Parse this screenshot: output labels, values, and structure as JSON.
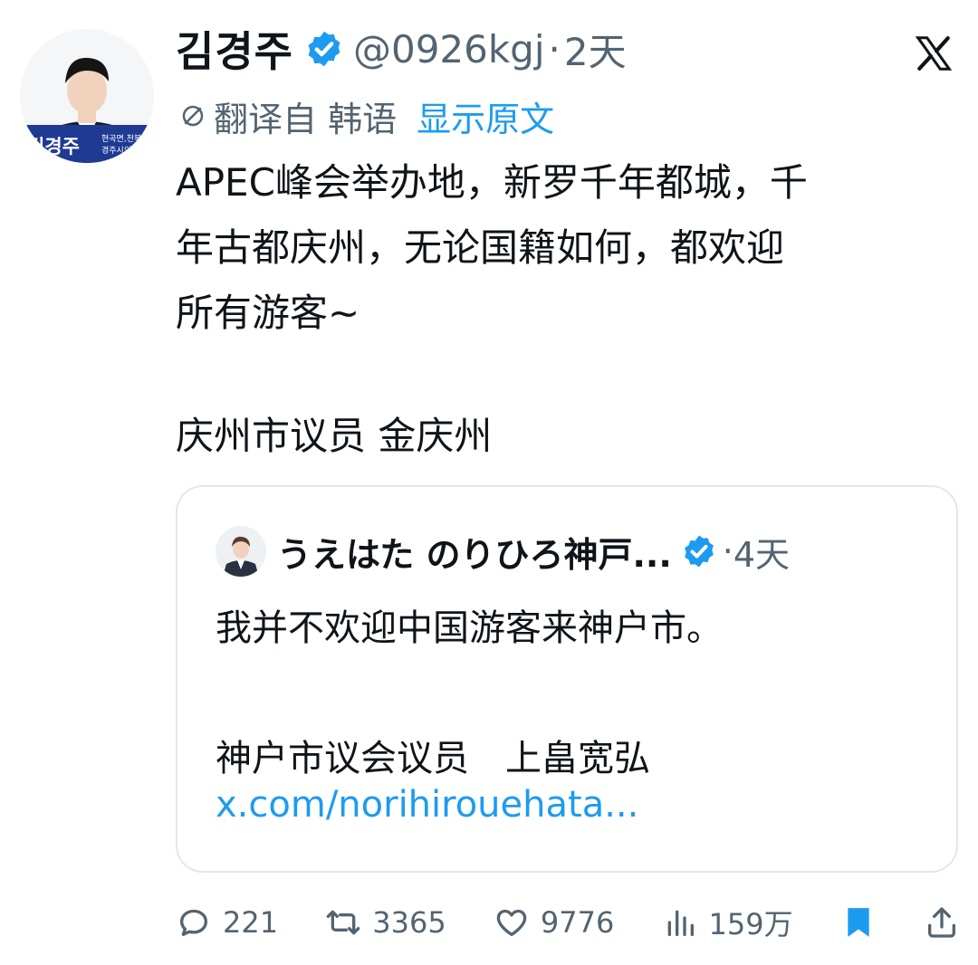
{
  "header": {
    "name": "김경주",
    "handle": "@0926kgj",
    "separator": "·",
    "time": "2天",
    "avatar_banner_name": "김경주",
    "avatar_banner_line1": "현곡면,천북면",
    "avatar_banner_line2": "경주시의원"
  },
  "translation": {
    "label": "翻译自 韩语",
    "show_original": "显示原文"
  },
  "tweet": {
    "text": "APEC峰会举办地，新罗千年都城，千\n年古都庆州，无论国籍如何，都欢迎\n所有游客~",
    "signature": "庆州市议员 金庆州"
  },
  "quote": {
    "name": "うえはた のりひろ神戸...",
    "separator": "·",
    "time": "4天",
    "text": "我并不欢迎中国游客来神户市。\n\n神户市议会议员　上畠宽弘",
    "link": "x.com/norihirouehata..."
  },
  "actions": {
    "replies": "221",
    "retweets": "3365",
    "likes": "9776",
    "views": "159万"
  },
  "colors": {
    "accent": "#1d9bf0",
    "secondary_text": "#536471",
    "primary_text": "#0f1419",
    "border": "#e1e8ed",
    "avatar_banner": "#1f3a93"
  },
  "icons": [
    "verified-badge-icon",
    "x-logo-icon",
    "translate-icon",
    "reply-icon",
    "retweet-icon",
    "like-icon",
    "views-icon",
    "bookmark-icon",
    "share-icon"
  ]
}
